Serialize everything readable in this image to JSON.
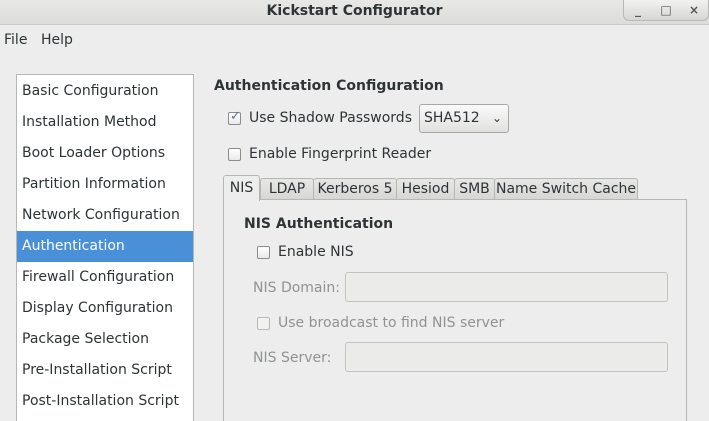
{
  "window": {
    "title": "Kickstart Configurator",
    "buttons": [
      "_",
      "□",
      "×"
    ]
  },
  "menu": [
    "File",
    "Help"
  ],
  "sidebar": {
    "items": [
      "Basic Configuration",
      "Installation Method",
      "Boot Loader Options",
      "Partition Information",
      "Network Configuration",
      "Authentication",
      "Firewall Configuration",
      "Display Configuration",
      "Package Selection",
      "Pre-Installation Script",
      "Post-Installation Script"
    ],
    "selected": "Authentication"
  },
  "auth": {
    "title": "Authentication Configuration",
    "shadow_label": "Use Shadow Passwords",
    "shadow_checked": true,
    "hash_value": "SHA512",
    "fingerprint_label": "Enable Fingerprint Reader",
    "fingerprint_checked": false
  },
  "tabs": [
    "NIS",
    "LDAP",
    "Kerberos 5",
    "Hesiod",
    "SMB",
    "Name Switch Cache"
  ],
  "active_tab": "NIS",
  "nis": {
    "section_title": "NIS Authentication",
    "enable_label": "Enable NIS",
    "enable_checked": false,
    "domain_label": "NIS Domain:",
    "domain_value": "",
    "broadcast_label": "Use broadcast to find NIS server",
    "broadcast_checked": false,
    "server_label": "NIS Server:",
    "server_value": ""
  },
  "colors": {
    "selection": "#4a90d9",
    "window_bg": "#ededed"
  }
}
